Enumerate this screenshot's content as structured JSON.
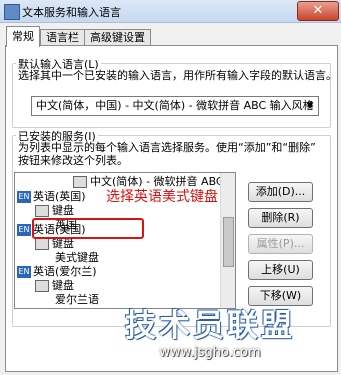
{
  "window": {
    "title": "文本服务和输入语言"
  },
  "tabs": [
    {
      "label": "常规"
    },
    {
      "label": "语言栏"
    },
    {
      "label": "高级键设置"
    }
  ],
  "default_language": {
    "group_label": "默认输入语言(L)",
    "description": "选择其中一个已安装的输入语言，用作所有输入字段的默认语言。",
    "selected": "中文(简体，中国) - 中文(简体) - 微软拼音 ABC 输入风格"
  },
  "installed_services": {
    "group_label": "已安装的服务(I)",
    "description_line1": "为列表中显示的每个输入语言选择服务。使用“添加”和“删除”",
    "description_line2": "按钮来修改这个列表。",
    "tree": [
      {
        "text": "中文(简体) - 微软拼音 ABC 输入风"
      },
      {
        "badge": "EN",
        "text": "英语(英国)"
      },
      {
        "text": "键盘"
      },
      {
        "text": "英国"
      },
      {
        "badge": "EN",
        "text": "英语(美国)"
      },
      {
        "text": "键盘"
      },
      {
        "text": "美式键盘"
      },
      {
        "badge": "EN",
        "text": "英语(爱尔兰)"
      },
      {
        "text": "键盘"
      },
      {
        "text": "爱尔兰语"
      }
    ],
    "buttons": {
      "add": "添加(D)...",
      "remove": "删除(R)",
      "properties": "属性(P)...",
      "move_up": "上移(U)",
      "move_down": "下移(W)"
    }
  },
  "annotation": {
    "callout": "选择英语美式键盘"
  },
  "watermark": {
    "line1": "技术员联盟",
    "line2": "www.jsgho.com"
  },
  "colors": {
    "callout": "#e01010",
    "badge": "#2a66c0"
  }
}
